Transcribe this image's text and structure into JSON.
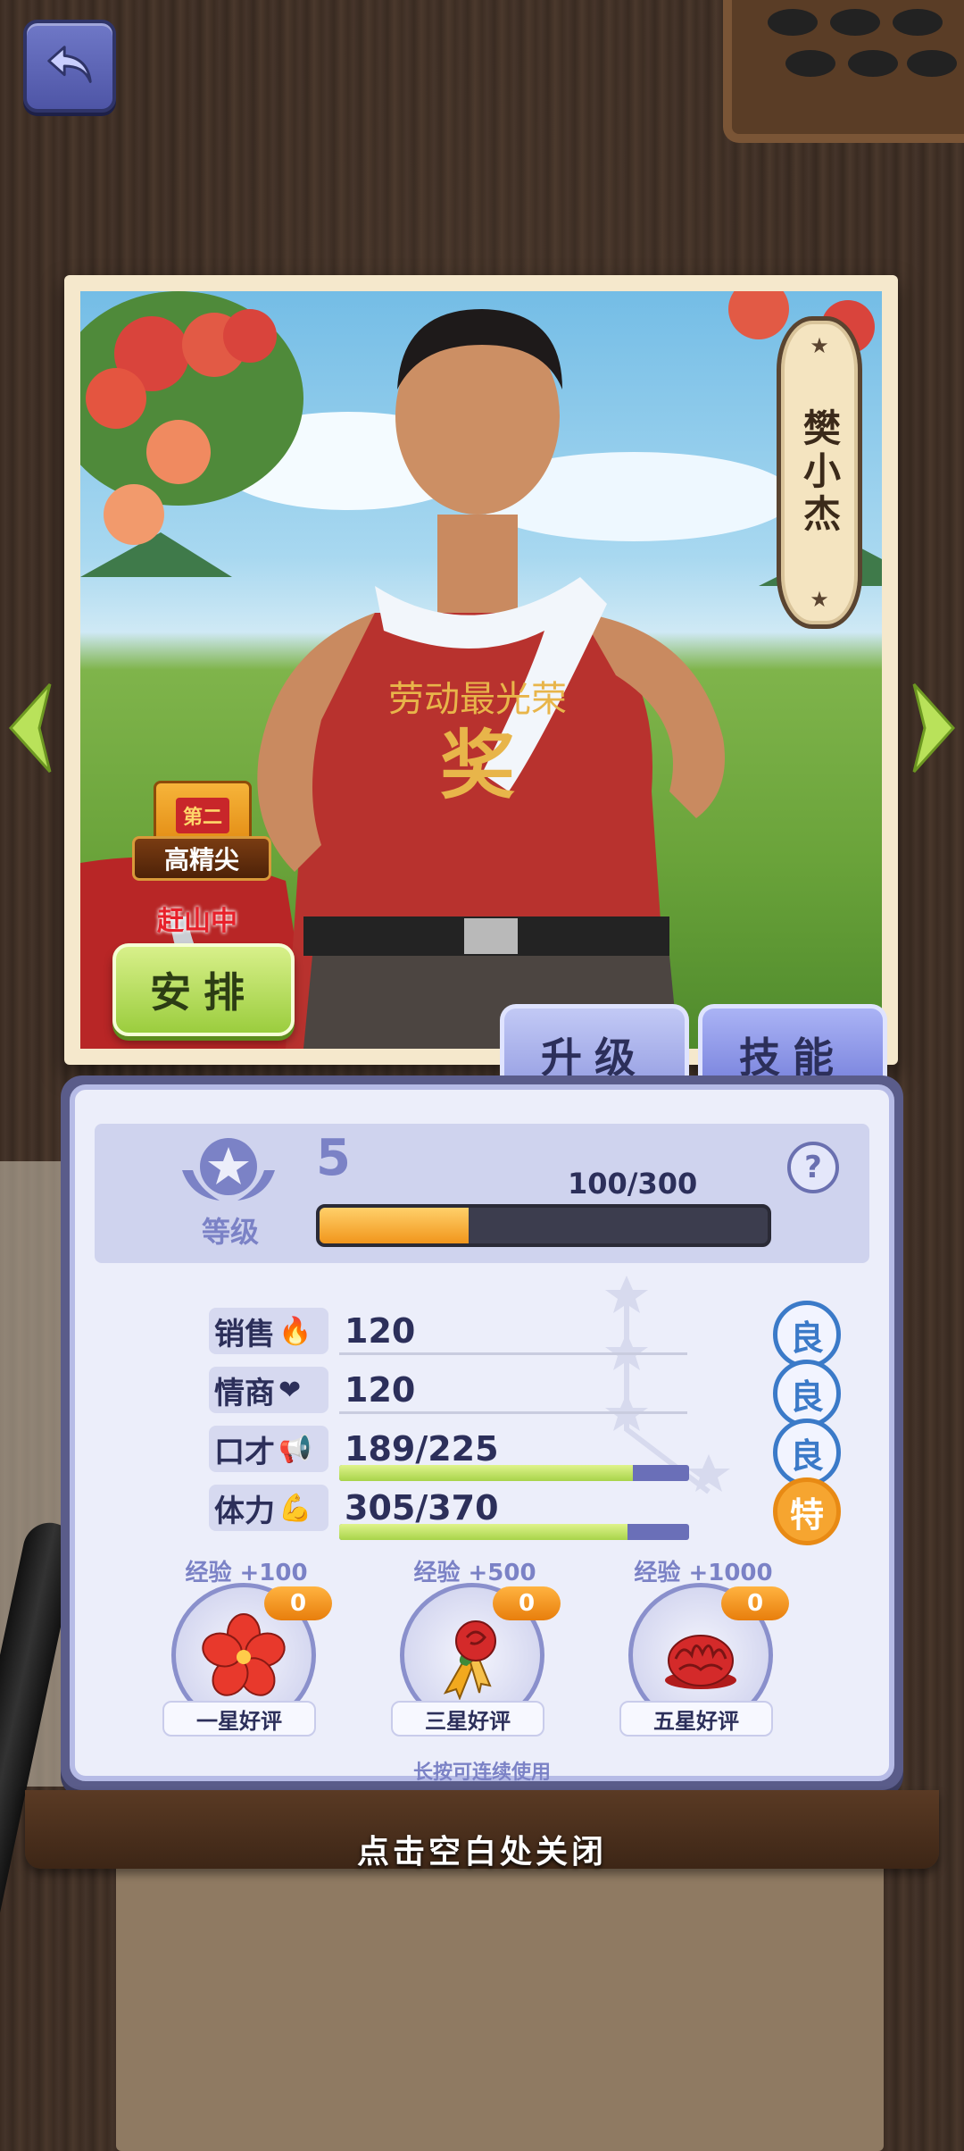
{
  "character": {
    "name": "樊小杰",
    "shirt_text_top": "劳动最光荣",
    "shirt_text_main": "奖"
  },
  "rank_badge": {
    "top": "第二",
    "label": "高精尖"
  },
  "status_text": "赶山中",
  "arrange_label": "安排",
  "tabs": [
    {
      "label": "升级"
    },
    {
      "label": "技能"
    }
  ],
  "level": {
    "label": "等级",
    "value": "5",
    "exp_text": "100/300",
    "exp_fraction": 0.333
  },
  "help_label": "?",
  "stats": [
    {
      "label": "销售",
      "icon": "flame-percent-icon",
      "value": "120",
      "grade": "良",
      "bar_fraction": null
    },
    {
      "label": "情商",
      "icon": "brain-heart-icon",
      "value": "120",
      "grade": "良",
      "bar_fraction": null
    },
    {
      "label": "口才",
      "icon": "megaphone-icon",
      "value": "189/225",
      "grade": "良",
      "bar_fraction": 0.84
    },
    {
      "label": "体力",
      "icon": "muscle-icon",
      "value": "305/370",
      "grade": "特",
      "bar_fraction": 0.824
    }
  ],
  "items": [
    {
      "exp": "经验 +100",
      "count": "0",
      "name": "一星好评",
      "icon": "red-flower-icon"
    },
    {
      "exp": "经验 +500",
      "count": "0",
      "name": "三星好评",
      "icon": "rose-ribbon-icon"
    },
    {
      "exp": "经验 +1000",
      "count": "0",
      "name": "五星好评",
      "icon": "red-carnation-icon"
    }
  ],
  "long_press_hint": "长按可连续使用",
  "close_hint": "点击空白处关闭",
  "colors": {
    "accent": "#7b82c6",
    "grade_good": "#3b7ac8",
    "grade_special": "#e88a14",
    "exp_fill": "#f1961c",
    "stat_fill": "#a8d44a"
  }
}
